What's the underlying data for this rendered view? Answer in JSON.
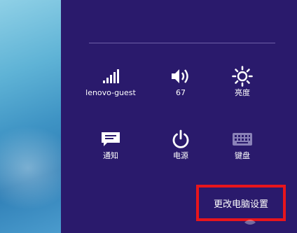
{
  "settings_panel": {
    "tiles": [
      {
        "label": "lenovo-guest",
        "icon": "wifi-signal-icon"
      },
      {
        "label": "67",
        "icon": "volume-icon"
      },
      {
        "label": "亮度",
        "icon": "brightness-icon"
      },
      {
        "label": "通知",
        "icon": "notifications-icon"
      },
      {
        "label": "电源",
        "icon": "power-icon"
      },
      {
        "label": "键盘",
        "icon": "keyboard-icon"
      }
    ],
    "change_pc_settings_label": "更改电脑设置",
    "highlight_color": "#e8151c",
    "panel_color": "#2a1a6c"
  }
}
